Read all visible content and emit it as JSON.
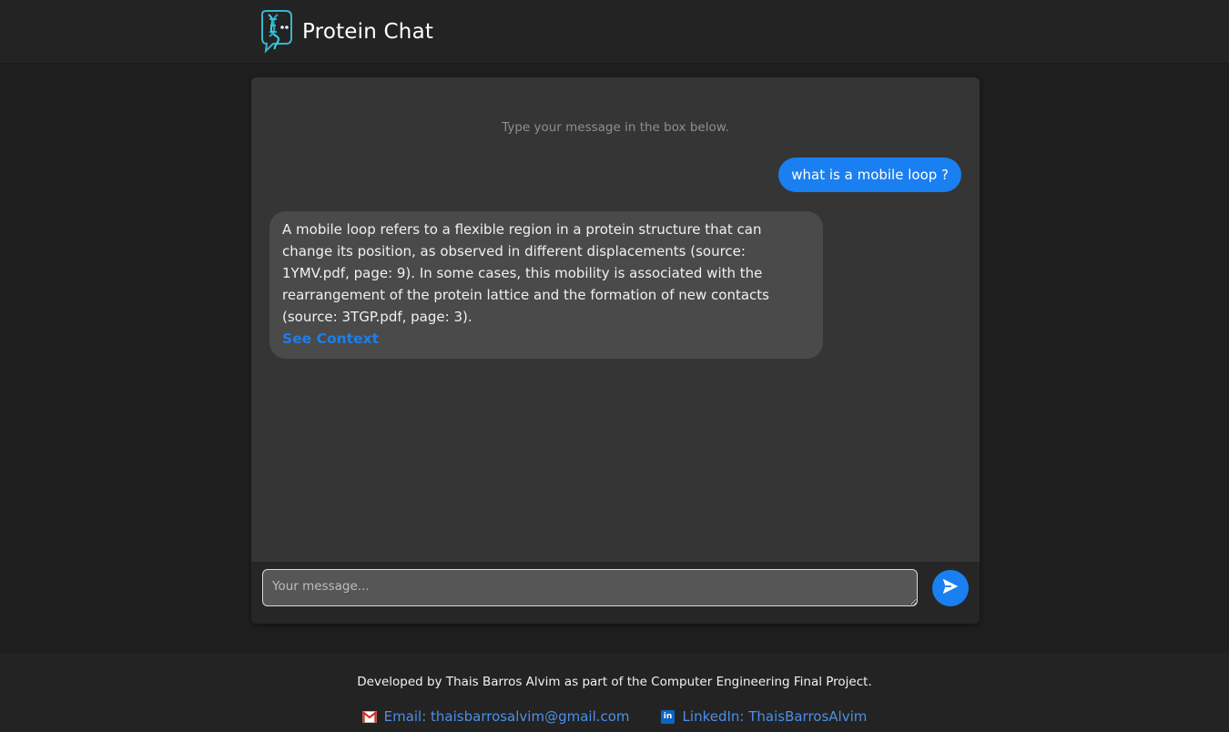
{
  "app": {
    "title": "Protein Chat",
    "logo_icon": "dna-chat-icon"
  },
  "chat": {
    "hint": "Type your message in the box below.",
    "messages": [
      {
        "role": "user",
        "text": "what is a mobile loop ?"
      },
      {
        "role": "bot",
        "text": "A mobile loop refers to a flexible region in a protein structure that can change its position, as observed in different displacements (source: 1YMV.pdf, page: 9). In some cases, this mobility is associated with the rearrangement of the protein lattice and the formation of new contacts (source: 3TGP.pdf, page: 3).",
        "context_link": "See Context"
      }
    ],
    "input_placeholder": "Your message...",
    "send_icon": "send-icon"
  },
  "footer": {
    "credit": "Developed by Thais Barros Alvim as part of the Computer Engineering Final Project.",
    "email_label": "Email: thaisbarrosalvim@gmail.com",
    "linkedin_label": "LinkedIn: ThaisBarrosAlvim"
  },
  "colors": {
    "accent": "#1a7ff0",
    "background": "#1e1e1e",
    "card": "#353535",
    "bot_bubble": "#4a4a4a",
    "footer_link": "#4b8fe8"
  }
}
